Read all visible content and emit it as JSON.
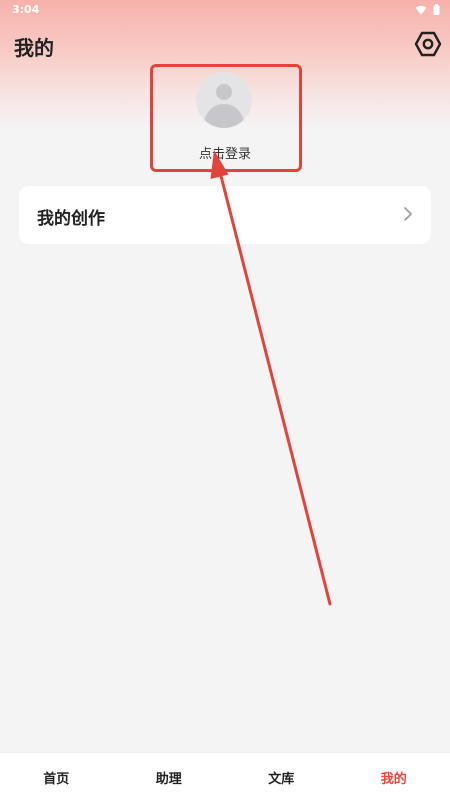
{
  "status_bar": {
    "time": "3:04",
    "icons": [
      "wifi-icon",
      "battery-icon"
    ]
  },
  "header": {
    "title": "我的",
    "settings_icon": "settings-icon"
  },
  "profile": {
    "login_label": "点击登录",
    "avatar_icon": "default-avatar-icon"
  },
  "menu": {
    "items": [
      {
        "label": "我的创作",
        "icon": "chevron-right-icon"
      }
    ]
  },
  "bottom_nav": {
    "items": [
      {
        "label": "首页",
        "active": false
      },
      {
        "label": "助理",
        "active": false
      },
      {
        "label": "文库",
        "active": false
      },
      {
        "label": "我的",
        "active": true
      }
    ]
  },
  "colors": {
    "accent": "#e9453b",
    "highlight_frame": "#e2443a",
    "background": "#f4f4f5",
    "card": "#ffffff"
  }
}
